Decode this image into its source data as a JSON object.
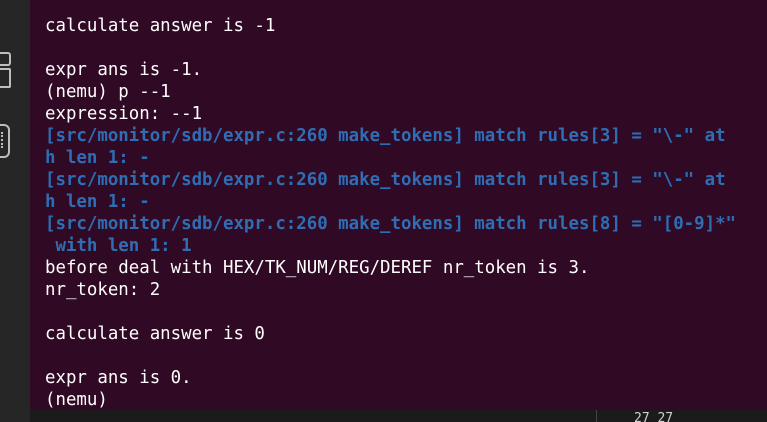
{
  "terminal": {
    "background": "#300a24",
    "text_color": "#ffffff",
    "log_color": "#2f6db5",
    "lines": [
      {
        "text": "calculate answer is -1",
        "style": "plain"
      },
      {
        "text": "",
        "style": "plain"
      },
      {
        "text": "expr ans is -1.",
        "style": "plain"
      },
      {
        "text": "(nemu) p --1",
        "style": "plain"
      },
      {
        "text": "expression: --1",
        "style": "plain"
      },
      {
        "text": "[src/monitor/sdb/expr.c:260 make_tokens] match rules[3] = \"\\-\" at",
        "style": "log"
      },
      {
        "text": "h len 1: -",
        "style": "log"
      },
      {
        "text": "[src/monitor/sdb/expr.c:260 make_tokens] match rules[3] = \"\\-\" at",
        "style": "log"
      },
      {
        "text": "h len 1: -",
        "style": "log"
      },
      {
        "text": "[src/monitor/sdb/expr.c:260 make_tokens] match rules[8] = \"[0-9]*\"",
        "style": "log"
      },
      {
        "text": " with len 1: 1",
        "style": "log"
      },
      {
        "text": "before deal with HEX/TK_NUM/REG/DEREF nr_token is 3.",
        "style": "plain"
      },
      {
        "text": "nr_token: 2",
        "style": "plain"
      },
      {
        "text": "",
        "style": "plain"
      },
      {
        "text": "calculate answer is 0",
        "style": "plain"
      },
      {
        "text": "",
        "style": "plain"
      },
      {
        "text": "expr ans is 0.",
        "style": "plain"
      },
      {
        "text": "(nemu)",
        "style": "plain"
      }
    ]
  },
  "editor_below": {
    "position_text": "27 27"
  },
  "icons": [
    "panel-icon",
    "split-icon",
    "scroll-icon"
  ]
}
